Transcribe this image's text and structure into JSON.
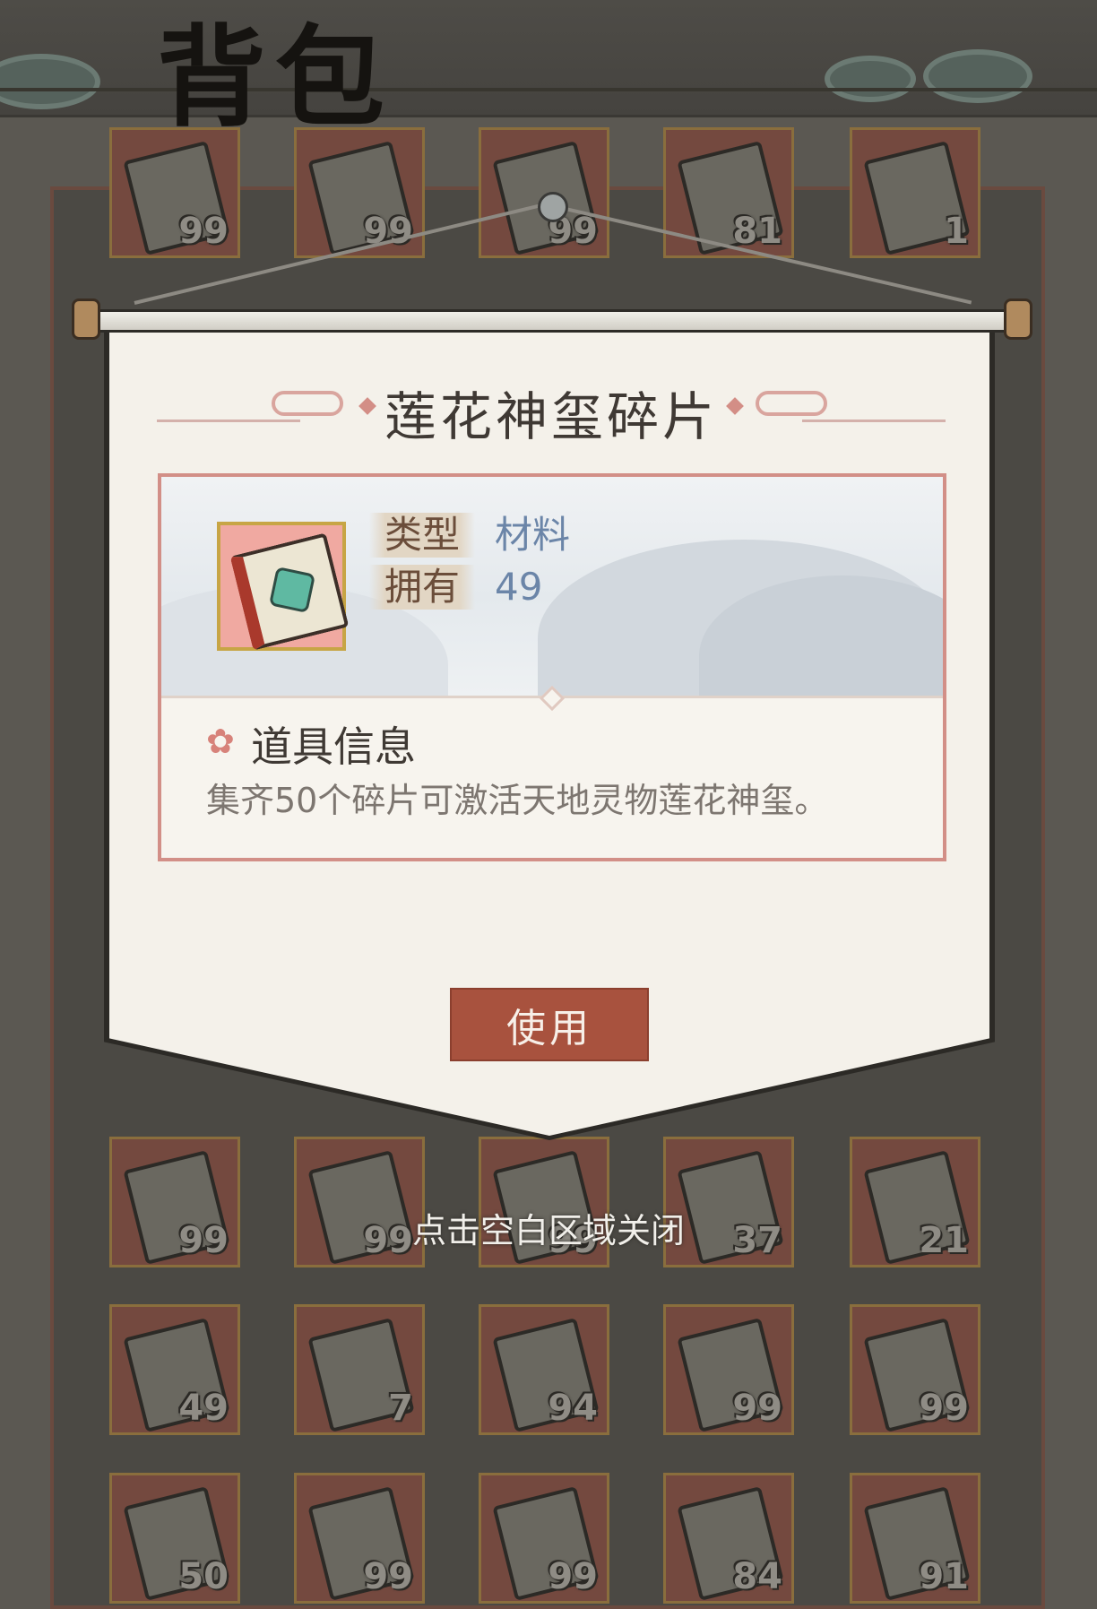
{
  "header": {
    "title": "背包"
  },
  "backpack": {
    "rows": [
      {
        "counts": [
          "99",
          "99",
          "99",
          "81",
          "1"
        ]
      },
      {
        "counts": [
          "99",
          "99",
          "99",
          "37",
          "21"
        ]
      },
      {
        "counts": [
          "49",
          "7",
          "94",
          "99",
          "99"
        ]
      },
      {
        "counts": [
          "50",
          "99",
          "99",
          "84",
          "91"
        ]
      }
    ]
  },
  "popup": {
    "title": "莲花神玺碎片",
    "props": [
      {
        "label": "类型",
        "value": "材料"
      },
      {
        "label": "拥有",
        "value": "49"
      }
    ],
    "section_title": "道具信息",
    "description": "集齐50个碎片可激活天地灵物莲花神玺。",
    "use_button": "使用",
    "close_hint": "点击空白区域关闭"
  },
  "colors": {
    "accent": "#a8523e",
    "value_text": "#6b85a8",
    "border_pink": "#d28f87"
  }
}
